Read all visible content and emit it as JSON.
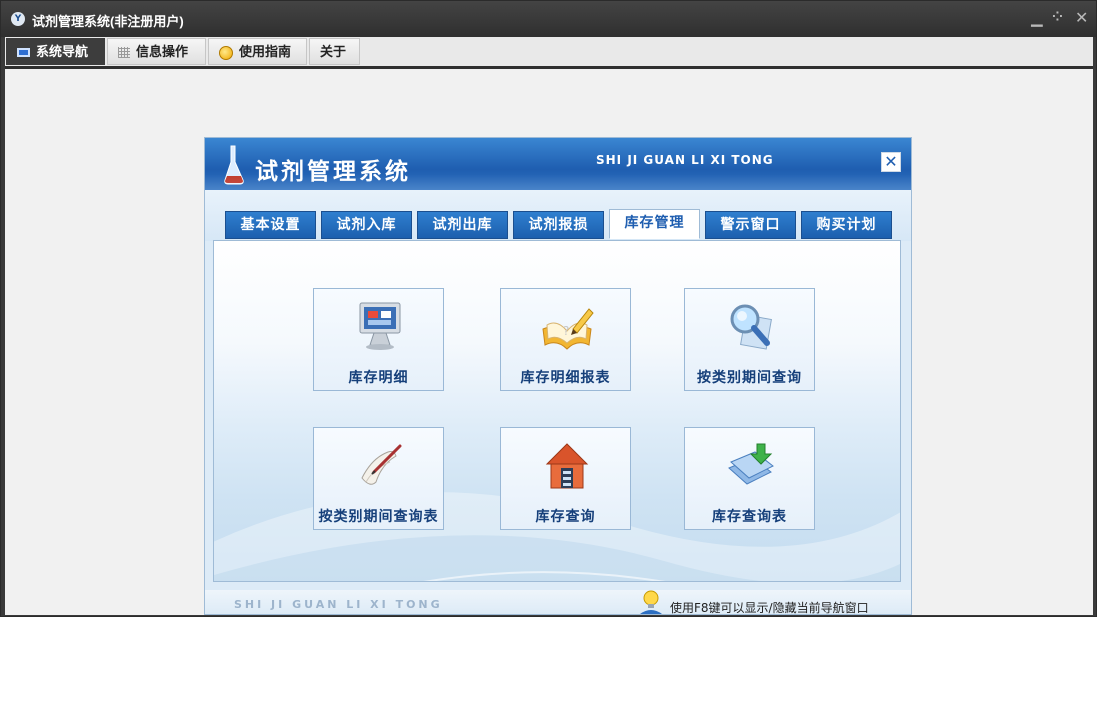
{
  "window": {
    "title": "试剂管理系统(非注册用户)",
    "icon": "app-logo-icon",
    "controls": [
      "minimize-icon",
      "restore-icon",
      "close-icon"
    ]
  },
  "menu": {
    "tabs": [
      {
        "label": "系统导航",
        "icon": "monitor-icon",
        "active": true
      },
      {
        "label": "信息操作",
        "icon": "grid-icon",
        "active": false
      },
      {
        "label": "使用指南",
        "icon": "smiley-icon",
        "active": false
      },
      {
        "label": "关于",
        "icon": "",
        "active": false
      }
    ]
  },
  "navigator": {
    "title": "试剂管理系统",
    "pinyin": "SHI JI GUAN LI XI TONG",
    "close_symbol": "✕",
    "tabs": [
      {
        "label": "基本设置",
        "active": false
      },
      {
        "label": "试剂入库",
        "active": false
      },
      {
        "label": "试剂出库",
        "active": false
      },
      {
        "label": "试剂报损",
        "active": false
      },
      {
        "label": "库存管理",
        "active": true
      },
      {
        "label": "警示窗口",
        "active": false
      },
      {
        "label": "购买计划",
        "active": false
      }
    ],
    "functions": [
      {
        "label": "库存明细",
        "icon": "monitor-icon"
      },
      {
        "label": "库存明细报表",
        "icon": "notebook-pencil-icon"
      },
      {
        "label": "按类别期间查询",
        "icon": "magnifier-icon"
      },
      {
        "label": "按类别期间查询表",
        "icon": "scroll-pen-icon"
      },
      {
        "label": "库存查询",
        "icon": "house-icon"
      },
      {
        "label": "库存查询表",
        "icon": "download-docs-icon"
      }
    ],
    "footer": {
      "pinyin": "SHI JI GUAN LI XI TONG",
      "hint": "使用F8键可以显示/隐藏当前导航窗口"
    }
  },
  "colors": {
    "accent_blue": "#1f5eb0",
    "window_chrome": "#2f2f2f"
  }
}
